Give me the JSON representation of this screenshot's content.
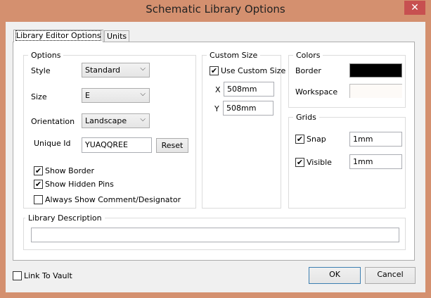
{
  "window": {
    "title": "Schematic Library Options",
    "close_icon": "close-icon"
  },
  "tabs": [
    {
      "label": "Library Editor Options",
      "active": true
    },
    {
      "label": "Units",
      "active": false
    }
  ],
  "options": {
    "title": "Options",
    "style_label": "Style",
    "style_value": "Standard",
    "size_label": "Size",
    "size_value": "E",
    "orientation_label": "Orientation",
    "orientation_value": "Landscape",
    "unique_id_label": "Unique Id",
    "unique_id_value": "YUAQQREE",
    "reset_label": "Reset",
    "checkboxes": [
      {
        "label": "Show Border",
        "checked": true
      },
      {
        "label": "Show Hidden Pins",
        "checked": true
      },
      {
        "label": "Always Show Comment/Designator",
        "checked": false
      }
    ]
  },
  "custom_size": {
    "title": "Custom Size",
    "use_label": "Use Custom Size",
    "use_checked": true,
    "x_label": "X",
    "x_value": "508mm",
    "y_label": "Y",
    "y_value": "508mm"
  },
  "colors": {
    "title": "Colors",
    "border_label": "Border",
    "border_color": "#000000",
    "workspace_label": "Workspace",
    "workspace_color": "#FDFAF7"
  },
  "grids": {
    "title": "Grids",
    "snap_label": "Snap",
    "snap_checked": true,
    "snap_value": "1mm",
    "visible_label": "Visible",
    "visible_checked": true,
    "visible_value": "1mm"
  },
  "description": {
    "title": "Library Description",
    "value": ""
  },
  "footer": {
    "link_vault_label": "Link To Vault",
    "link_vault_checked": false,
    "ok_label": "OK",
    "cancel_label": "Cancel"
  },
  "check_mark": "✔"
}
